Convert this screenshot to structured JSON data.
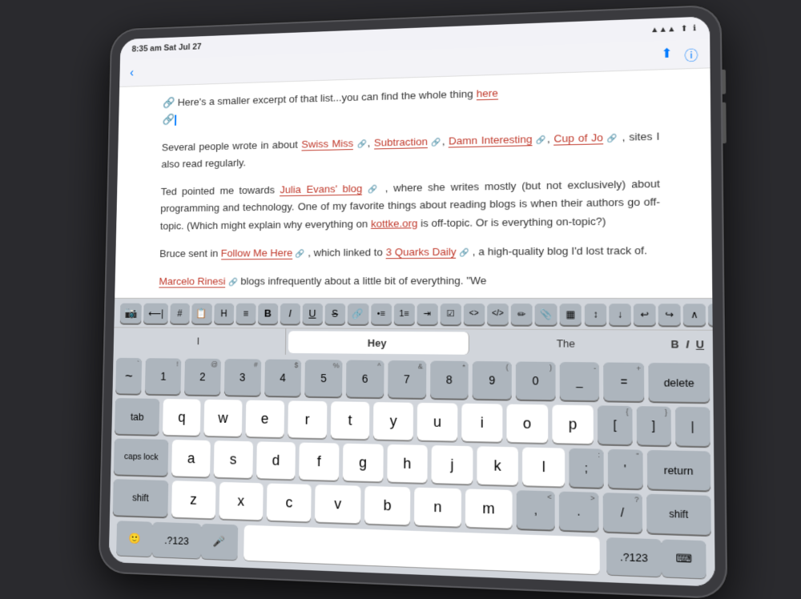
{
  "status": {
    "time": "8:35 am  Sat Jul 27"
  },
  "editor": {
    "paragraph1": "Here's a smaller excerpt of that list...you can find the whole thing",
    "here_link": "here",
    "paragraph2": "Several people wrote in about",
    "swiss_miss": "Swiss Miss",
    "subtraction": "Subtraction",
    "damn_interesting": "Damn Interesting",
    "cup_of_jo": "Cup of Jo",
    "paragraph2_end": ", sites I also read regularly.",
    "paragraph3_start": "Ted pointed me towards",
    "julia_evans": "Julia Evans' blog",
    "paragraph3_mid": ", where she writes mostly (but not exclusively) about programming and technology. One of my favorite things about reading blogs is when their authors go off-topic. (Which might explain why everything on",
    "kottke": "kottke.org",
    "paragraph3_end": "is off-topic. Or is everything on-topic?)",
    "paragraph4_start": "Bruce sent in",
    "follow_me_here": "Follow Me Here",
    "paragraph4_mid": ", which linked to",
    "quarks_daily": "3 Quarks Daily",
    "paragraph4_end": ", a high-quality blog I'd lost track of.",
    "paragraph5_start": "Marcelo Rinesi",
    "paragraph5_end": "blogs infrequently about a little bit of everything. \"We"
  },
  "predictive": {
    "word1": "I",
    "word2": "Hey",
    "word3": "The"
  },
  "keyboard": {
    "row1": [
      "~`",
      "!1",
      "@2",
      "#3",
      "$4",
      "%5",
      "^6",
      "&7",
      "*8",
      "(9",
      ")0",
      "-_",
      "+="
    ],
    "row_qwerty": [
      "q",
      "w",
      "e",
      "r",
      "t",
      "y",
      "u",
      "i",
      "o",
      "p"
    ],
    "row_asdf": [
      "a",
      "s",
      "d",
      "f",
      "g",
      "h",
      "j",
      "k",
      "l"
    ],
    "row_zxcv": [
      "z",
      "x",
      "c",
      "v",
      "b",
      "n",
      "m"
    ],
    "delete_label": "delete",
    "tab_label": "tab",
    "caps_label": "caps lock",
    "return_label": "return",
    "shift_label": "shift",
    "emoji_label": "🙂",
    "num_label": ".?123",
    "mic_label": "🎤",
    "spacebar_label": "",
    "keyboard_icon": "⌨"
  },
  "toolbar": {
    "bold": "B",
    "italic": "I",
    "underline": "U"
  }
}
